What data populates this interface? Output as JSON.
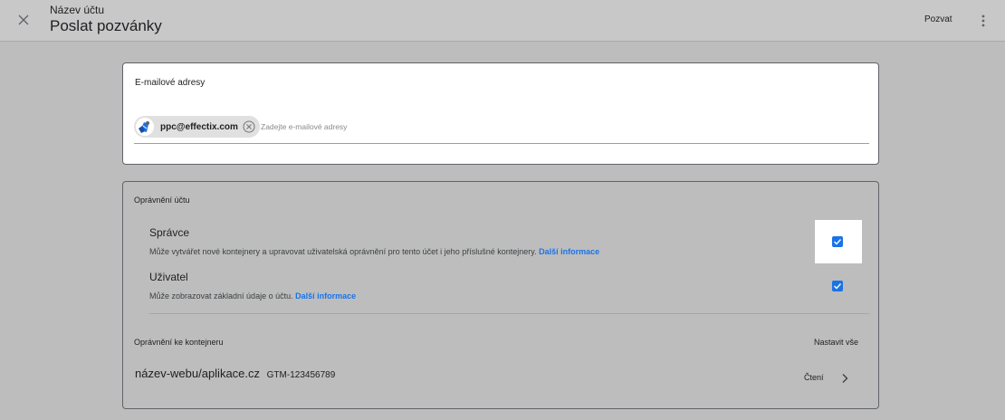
{
  "header": {
    "account_name": "Název účtu",
    "page_title": "Poslat pozvánky",
    "invite_label": "Pozvat",
    "close_icon": "close-icon",
    "more_icon": "more-vert-icon"
  },
  "email_section": {
    "heading": "E-mailové adresy",
    "chips": [
      {
        "email": "ppc@effectix.com",
        "avatar_icon": "avatar-icon",
        "remove_icon": "remove-chip-icon"
      }
    ],
    "input_value": "",
    "input_placeholder": "Zadejte e-mailové adresy"
  },
  "account_permissions": {
    "heading": "Oprávnění účtu",
    "roles": [
      {
        "title": "Správce",
        "description": "Může vytvářet nové kontejnery a upravovat uživatelská oprávnění pro tento účet i jeho příslušné kontejnery.",
        "link": "Další informace",
        "checked": true
      },
      {
        "title": "Uživatel",
        "description": "Může zobrazovat základní údaje o účtu.",
        "link": "Další informace",
        "checked": true
      }
    ]
  },
  "container_permissions": {
    "heading": "Oprávnění ke kontejneru",
    "set_all_label": "Nastavit vše",
    "containers": [
      {
        "name": "název-webu/aplikace.cz",
        "id": "GTM-123456789",
        "permission": "Čtení"
      }
    ]
  },
  "colors": {
    "accent": "#1a73e8",
    "overlay": "#bdbdbd",
    "card": "#ffffff"
  }
}
